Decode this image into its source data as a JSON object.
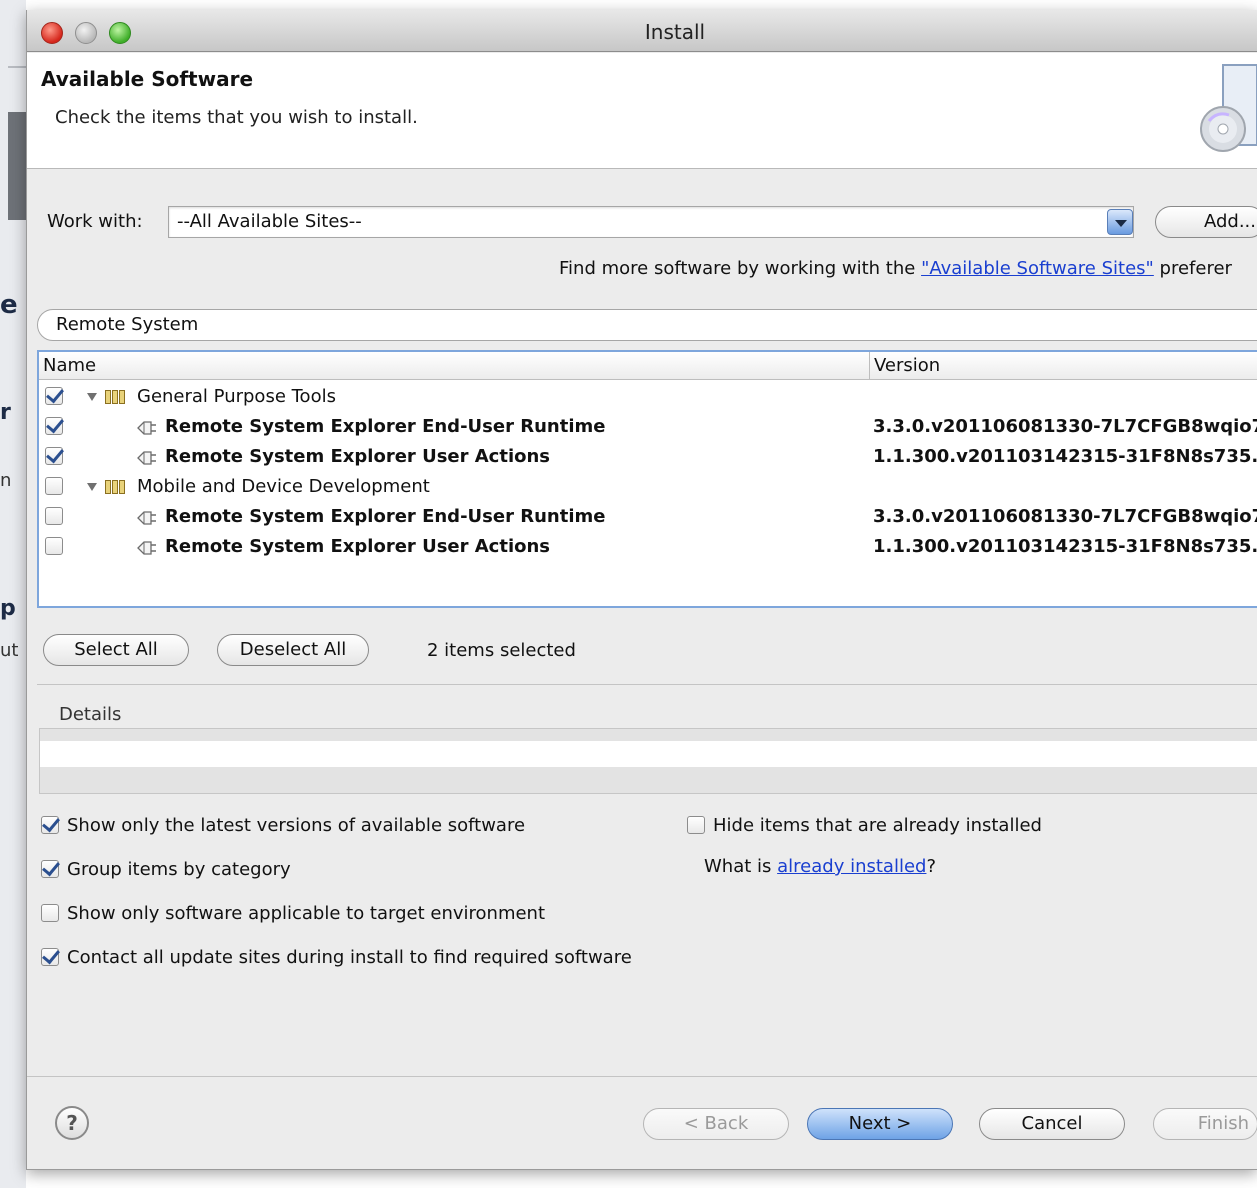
{
  "background": {
    "glyphs": [
      "e",
      "r",
      "n",
      "p",
      "ut"
    ]
  },
  "window": {
    "title": "Install"
  },
  "banner": {
    "title": "Available Software",
    "subtitle": "Check the items that you wish to install."
  },
  "work_with": {
    "label": "Work with:",
    "value": "--All Available Sites--",
    "add_label": "Add...",
    "find_more_prefix": "Find more software by working with the ",
    "find_more_link": "\"Available Software Sites\"",
    "find_more_suffix": " preferer"
  },
  "filter": {
    "value": "Remote System"
  },
  "tree": {
    "columns": {
      "name": "Name",
      "version": "Version"
    },
    "rows": [
      {
        "type": "category",
        "label": "General Purpose Tools",
        "checked": true,
        "version": ""
      },
      {
        "type": "feature",
        "label": "Remote System Explorer End-User Runtime",
        "checked": true,
        "version": "3.3.0.v201106081330-7L7CFGB8wqio7"
      },
      {
        "type": "feature",
        "label": "Remote System Explorer User Actions",
        "checked": true,
        "version": "1.1.300.v201103142315-31F8N8s735."
      },
      {
        "type": "category",
        "label": "Mobile and Device Development",
        "checked": false,
        "version": ""
      },
      {
        "type": "feature",
        "label": "Remote System Explorer End-User Runtime",
        "checked": false,
        "version": "3.3.0.v201106081330-7L7CFGB8wqio7"
      },
      {
        "type": "feature",
        "label": "Remote System Explorer User Actions",
        "checked": false,
        "version": "1.1.300.v201103142315-31F8N8s735."
      }
    ]
  },
  "selection": {
    "select_all": "Select All",
    "deselect_all": "Deselect All",
    "status": "2 items selected"
  },
  "details": {
    "label": "Details"
  },
  "options": {
    "latest_versions": {
      "label": "Show only the latest versions of available software",
      "checked": true
    },
    "group_by_category": {
      "label": "Group items by category",
      "checked": true
    },
    "target_env": {
      "label": "Show only software applicable to target environment",
      "checked": false
    },
    "contact_sites": {
      "label": "Contact all update sites during install to find required software",
      "checked": true
    },
    "hide_installed": {
      "label": "Hide items that are already installed",
      "checked": false
    },
    "what_is_prefix": "What is ",
    "what_is_link": "already installed",
    "what_is_suffix": "?"
  },
  "footer": {
    "help": "?",
    "back": "< Back",
    "next": "Next >",
    "cancel": "Cancel",
    "finish": "Finish"
  },
  "colors": {
    "accent": "#6ea3e6",
    "link": "#1a3fd0",
    "check": "#2b4f8f"
  }
}
